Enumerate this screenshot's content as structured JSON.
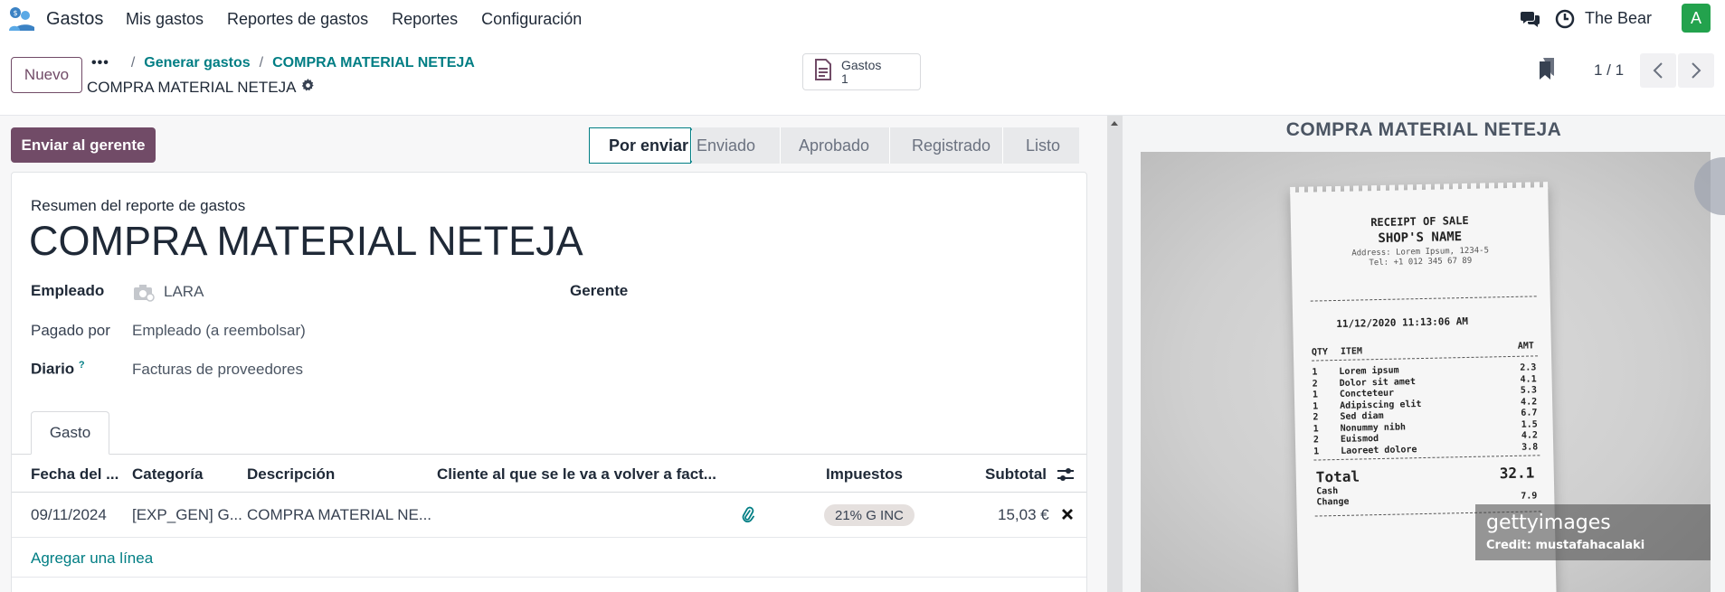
{
  "navbar": {
    "app_name": "Gastos",
    "menu": [
      "Mis gastos",
      "Reportes de gastos",
      "Reportes",
      "Configuración"
    ],
    "user_name": "The Bear",
    "avatar_letter": "A",
    "avatar_color": "#23a24d"
  },
  "control": {
    "new_label": "Nuevo",
    "breadcrumb": [
      "Generar gastos",
      "COMPRA MATERIAL NETEJA"
    ],
    "record_name": "COMPRA MATERIAL NETEJA",
    "smart_button": {
      "label": "Gastos",
      "count": "1"
    },
    "pager": "1 / 1"
  },
  "actions": {
    "send_label": "Enviar al gerente"
  },
  "statusbar": {
    "stages": [
      "Por enviar",
      "Enviado",
      "Aprobado",
      "Registrado",
      "Listo"
    ],
    "active": "Por enviar"
  },
  "form": {
    "subtitle": "Resumen del reporte de gastos",
    "title": "COMPRA MATERIAL NETEJA",
    "employee_label": "Empleado",
    "employee_value": "LARA",
    "manager_label": "Gerente",
    "paid_by_label": "Pagado por",
    "paid_by_value": "Empleado (a reembolsar)",
    "journal_label": "Diario",
    "journal_help": "?",
    "journal_value": "Facturas de proveedores"
  },
  "tabs": [
    "Gasto"
  ],
  "table": {
    "headers": [
      "Fecha del ...",
      "Categoría",
      "Descripción",
      "Cliente al que se le va a volver a fact...",
      "Impuestos",
      "Subtotal"
    ],
    "rows": [
      {
        "date": "09/11/2024",
        "category": "[EXP_GEN] G...",
        "description": "COMPRA MATERIAL NE...",
        "customer": "",
        "tax": "21% G INC",
        "subtotal": "15,03 €"
      }
    ],
    "add_line": "Agregar una línea"
  },
  "viewer": {
    "title": "COMPRA MATERIAL NETEJA",
    "receipt": {
      "header1": "RECEIPT OF SALE",
      "header2": "SHOP'S NAME",
      "address": "Address: Lorem Ipsum, 1234-5",
      "tel": "Tel: +1 012 345 67 89",
      "datetime": "11/12/2020  11:13:06 AM",
      "col_qty": "QTY",
      "col_item": "ITEM",
      "col_amt": "AMT",
      "items": [
        {
          "qty": "1",
          "item": "Lorem ipsum",
          "amt": "2.3"
        },
        {
          "qty": "2",
          "item": "Dolor sit amet",
          "amt": "4.1"
        },
        {
          "qty": "1",
          "item": "Concteteur",
          "amt": "5.3"
        },
        {
          "qty": "1",
          "item": "Adipiscing elit",
          "amt": "4.2"
        },
        {
          "qty": "2",
          "item": "Sed diam",
          "amt": "6.7"
        },
        {
          "qty": "1",
          "item": "Nonummy nibh",
          "amt": "1.5"
        },
        {
          "qty": "2",
          "item": "Euismod",
          "amt": "4.2"
        },
        {
          "qty": "1",
          "item": "Laoreet dolore",
          "amt": "3.8"
        }
      ],
      "total_label": "Total",
      "total_value": "32.1",
      "cash_label": "Cash",
      "change_label": "Change",
      "change_value": "7.9"
    },
    "watermark_logo": "gettyimages",
    "watermark_credit": "Credit: mustafahacalaki"
  }
}
